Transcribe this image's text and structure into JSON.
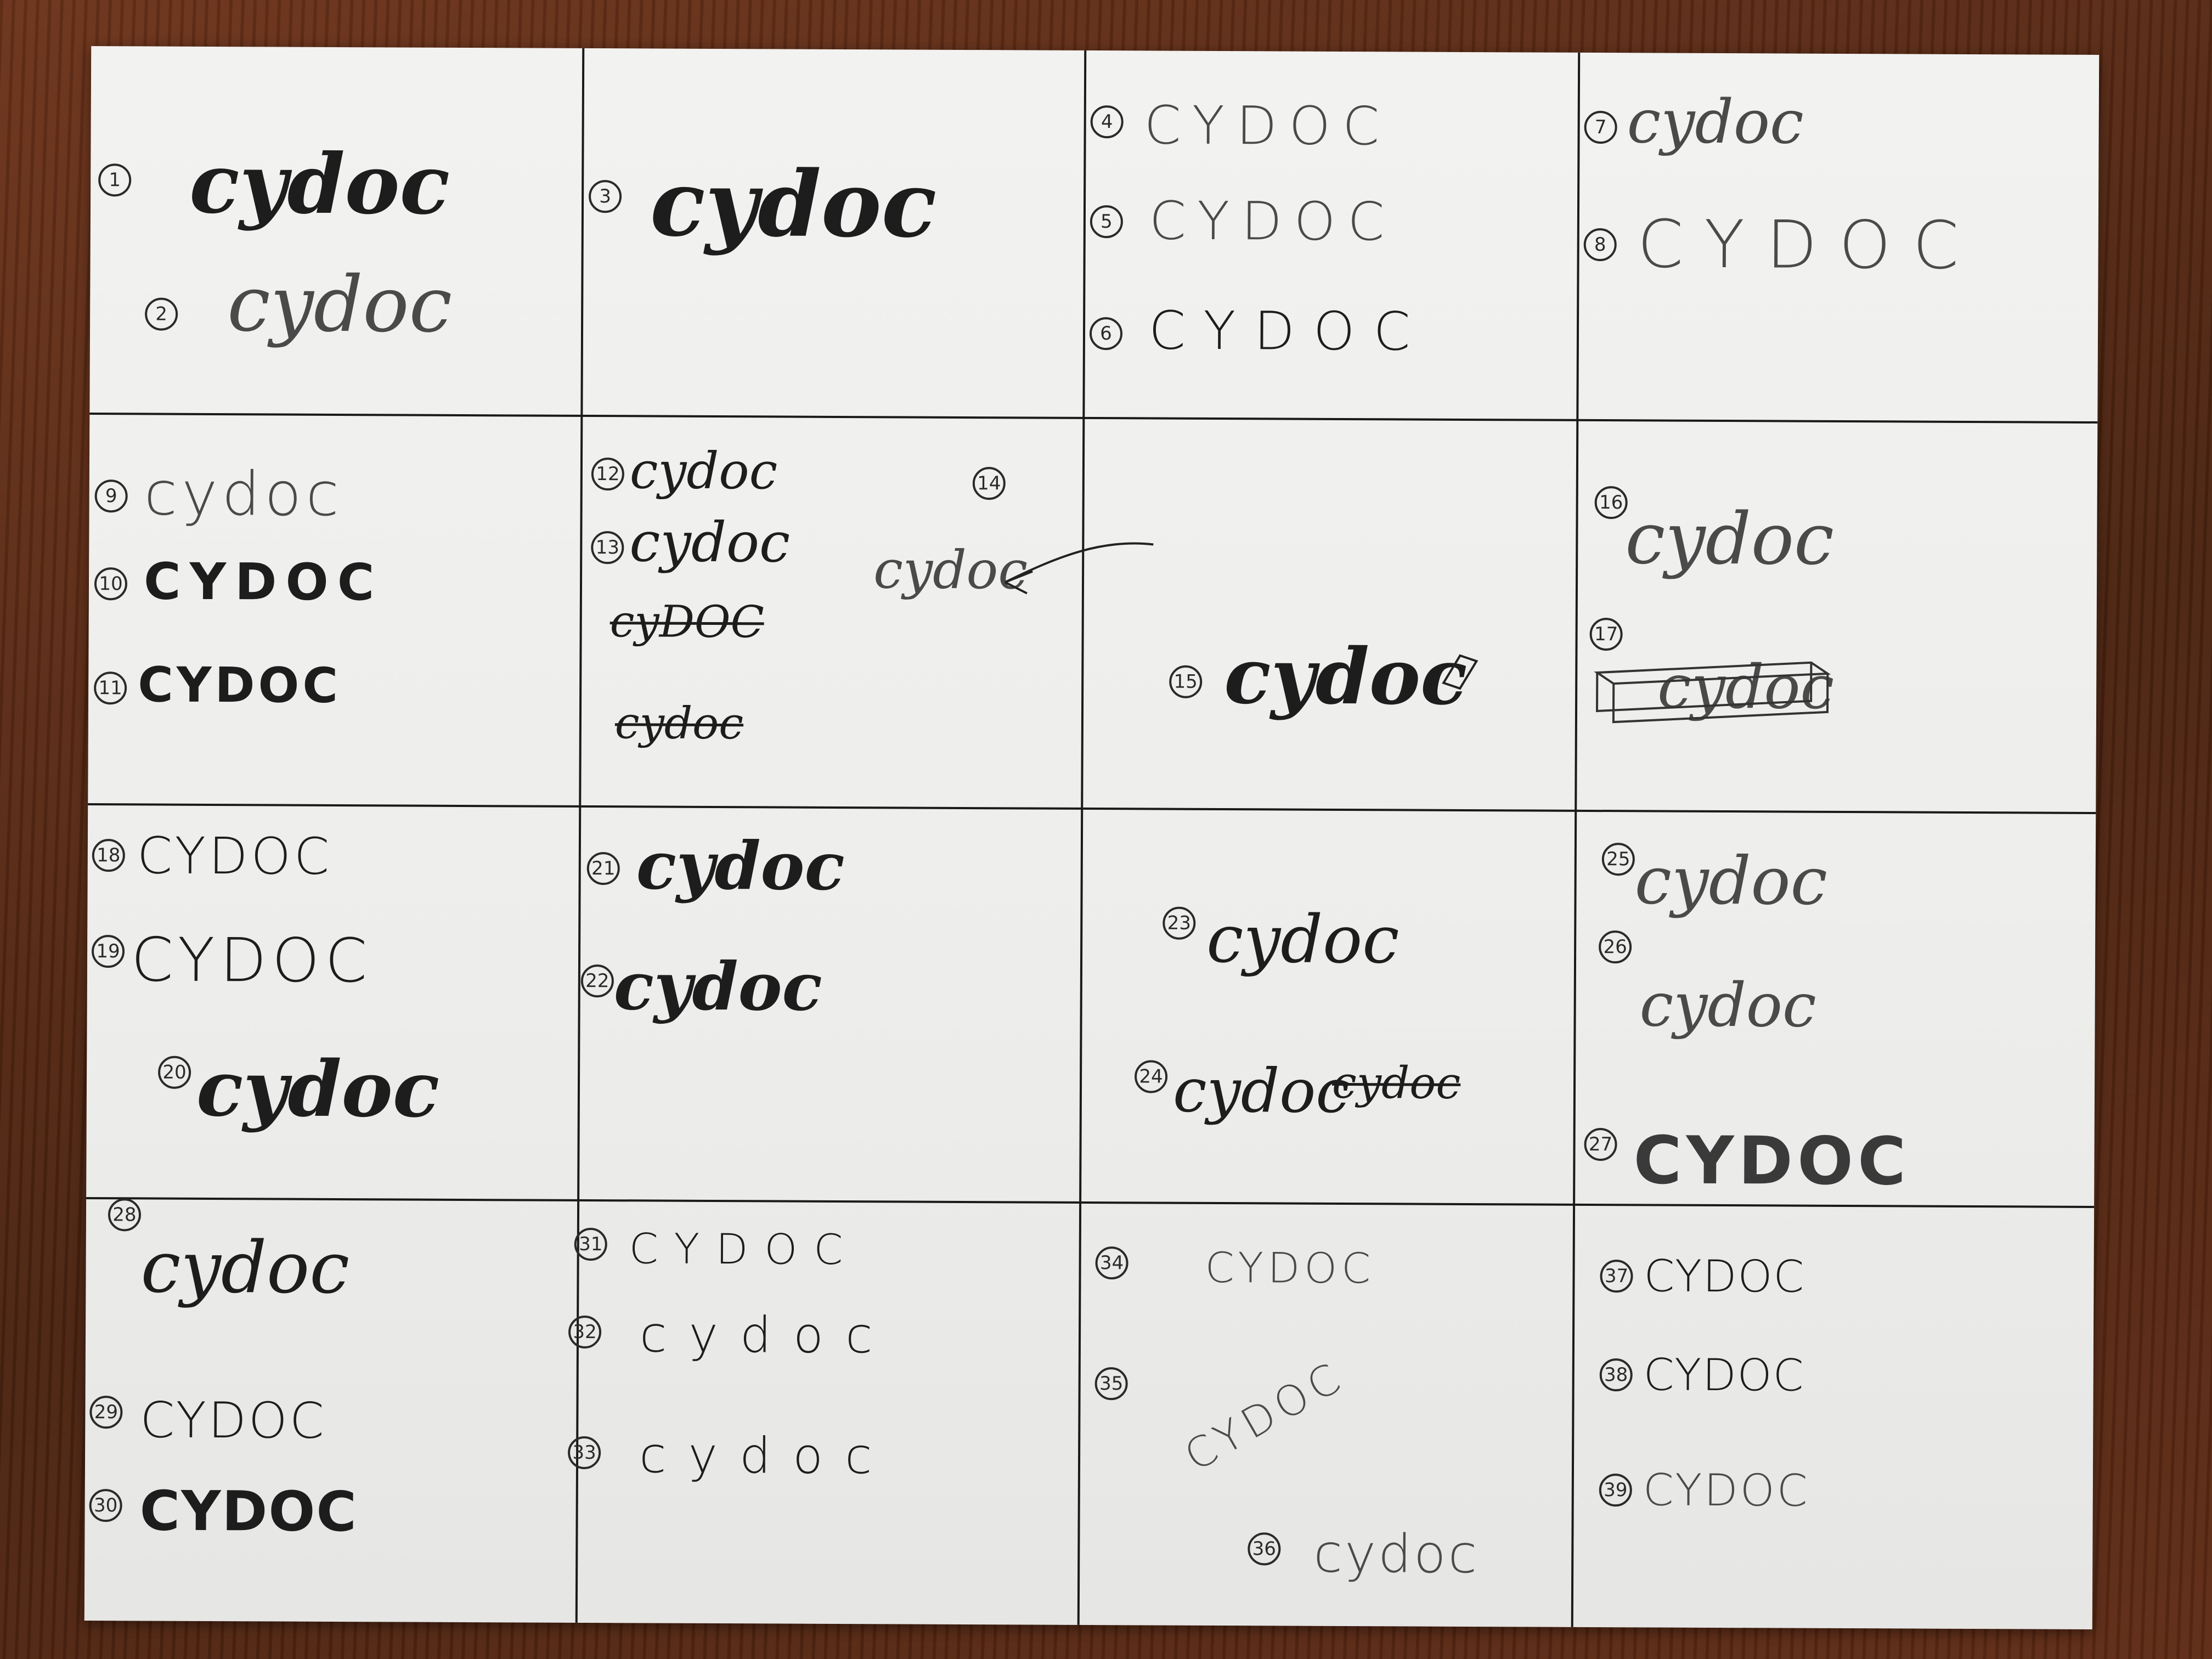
{
  "sketches": [
    {
      "num": "1",
      "text": "cydoc"
    },
    {
      "num": "2",
      "text": "cydoc"
    },
    {
      "num": "3",
      "text": "cydoc"
    },
    {
      "num": "4",
      "text": "CYDOC"
    },
    {
      "num": "5",
      "text": "CYDOC"
    },
    {
      "num": "6",
      "text": "CYDOC"
    },
    {
      "num": "7",
      "text": "cydoc"
    },
    {
      "num": "8",
      "text": "CYDOC"
    },
    {
      "num": "9",
      "text": "cydoc"
    },
    {
      "num": "10",
      "text": "CYDOC"
    },
    {
      "num": "11",
      "text": "CYDOC"
    },
    {
      "num": "12",
      "text": "cydoc"
    },
    {
      "num": "13",
      "text": "cydoc"
    },
    {
      "num": "14",
      "text": "cydoc"
    },
    {
      "num": "15",
      "text": "cydoc"
    },
    {
      "num": "16",
      "text": "cydoc"
    },
    {
      "num": "17",
      "text": "cydoc"
    },
    {
      "num": "18",
      "text": "CYDOC"
    },
    {
      "num": "19",
      "text": "CYDOC"
    },
    {
      "num": "20",
      "text": "cydoc"
    },
    {
      "num": "21",
      "text": "cydoc"
    },
    {
      "num": "22",
      "text": "cydoc"
    },
    {
      "num": "23",
      "text": "cydoc"
    },
    {
      "num": "24",
      "text": "cydoc"
    },
    {
      "num": "25",
      "text": "cydoc"
    },
    {
      "num": "26",
      "text": "cydoc"
    },
    {
      "num": "27",
      "text": "CYDOC"
    },
    {
      "num": "28",
      "text": "cydoc"
    },
    {
      "num": "29",
      "text": "CYDOC"
    },
    {
      "num": "30",
      "text": "CYDOC"
    },
    {
      "num": "31",
      "text": "CYDOC"
    },
    {
      "num": "32",
      "text": "cydoc"
    },
    {
      "num": "33",
      "text": "cydoc"
    },
    {
      "num": "34",
      "text": "CYDOC"
    },
    {
      "num": "35",
      "text": "CYDOC"
    },
    {
      "num": "36",
      "text": "cydoc"
    },
    {
      "num": "37",
      "text": "CYDOC"
    },
    {
      "num": "38",
      "text": "CYDOC"
    },
    {
      "num": "39",
      "text": "CYDOC"
    }
  ],
  "crossed": [
    {
      "text": "cyDOC"
    },
    {
      "text": "cydoc"
    },
    {
      "text": "cydoc"
    }
  ],
  "colors": {
    "ink": "#1d1d1d",
    "paper": "#f0f0ee",
    "table": "#5a2b16"
  }
}
